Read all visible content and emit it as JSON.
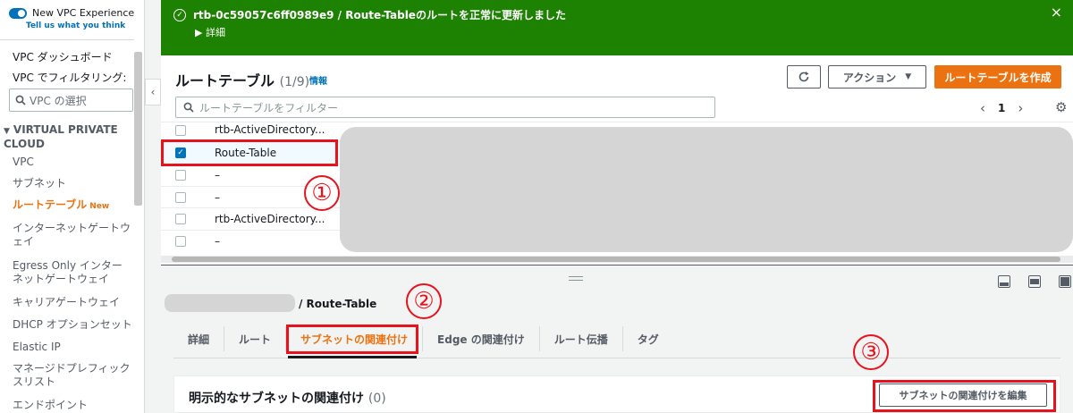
{
  "sidebar": {
    "toggle_label": "New VPC Experience",
    "tell_us": "Tell us what you think",
    "dashboard": "VPC ダッシュボード",
    "filter_label": "VPC でフィルタリング:",
    "vpc_select_placeholder": "VPC の選択",
    "section_heading": "VIRTUAL PRIVATE CLOUD",
    "items": [
      {
        "label": "VPC"
      },
      {
        "label": "サブネット"
      },
      {
        "label": "ルートテーブル",
        "badge": "New"
      },
      {
        "label": "インターネットゲートウェイ"
      },
      {
        "label": "Egress Only インターネットゲートウェイ"
      },
      {
        "label": "キャリアゲートウェイ"
      },
      {
        "label": "DHCP オプションセット"
      },
      {
        "label": "Elastic IP"
      },
      {
        "label": "マネージドプレフィックスリスト"
      },
      {
        "label": "エンドポイント"
      }
    ]
  },
  "flash": {
    "message": "rtb-0c59057c6ff0989e9 / Route-Tableのルートを正常に更新しました",
    "detail": "詳細",
    "color": "#1d8102"
  },
  "route_tables": {
    "title": "ルートテーブル",
    "count": "(1/9)",
    "info": "情報",
    "actions_label": "アクション",
    "create_label": "ルートテーブルを作成",
    "filter_placeholder": "ルートテーブルをフィルター",
    "page": "1",
    "rows": [
      {
        "name": "rtb-ActiveDirectory...",
        "checked": false
      },
      {
        "name": "Route-Table",
        "checked": true
      },
      {
        "name": "–",
        "checked": false
      },
      {
        "name": "–",
        "checked": false
      },
      {
        "name": "rtb-ActiveDirectory...",
        "checked": false
      },
      {
        "name": "–",
        "checked": false
      }
    ]
  },
  "details": {
    "title": "/ Route-Table",
    "tabs": [
      "詳細",
      "ルート",
      "サブネットの関連付け",
      "Edge の関連付け",
      "ルート伝播",
      "タグ"
    ],
    "active_tab": "サブネットの関連付け",
    "explicit_title": "明示的なサブネットの関連付け",
    "explicit_count": "(0)",
    "edit_button": "サブネットの関連付けを編集"
  },
  "annotations": [
    "①",
    "②",
    "③"
  ],
  "colors": {
    "accent": "#ec7211",
    "link": "#0073bb",
    "annotation": "#e8121d"
  }
}
